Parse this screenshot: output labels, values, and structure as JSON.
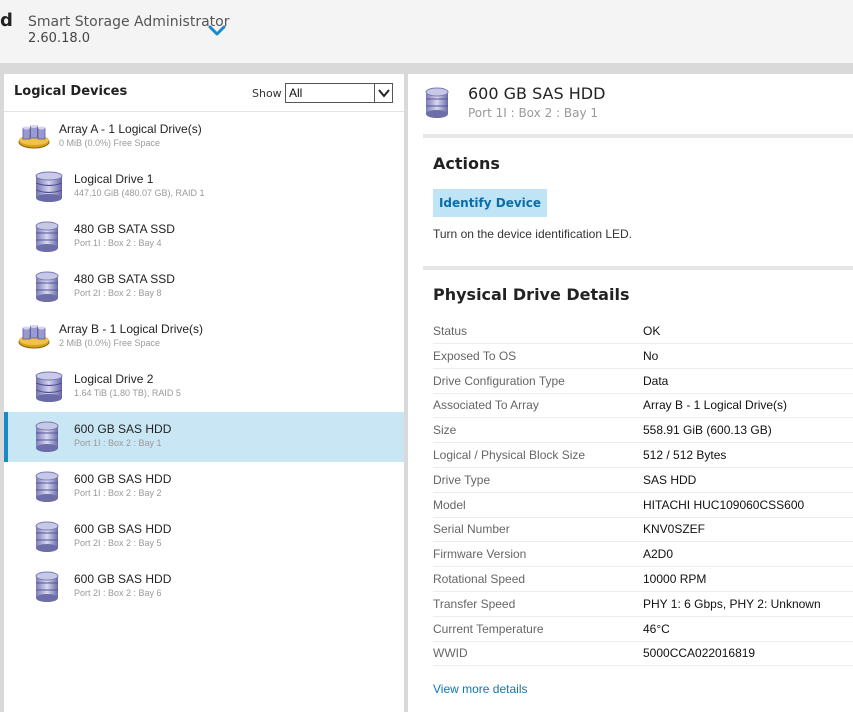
{
  "header": {
    "brand_letter": "d",
    "app_title": "Smart Storage Administrator",
    "app_version": "2.60.18.0"
  },
  "left": {
    "title": "Logical Devices",
    "show_label": "Show",
    "show_value": "All",
    "items": [
      {
        "name": "Array A - 1 Logical Drive(s)",
        "sub": "0 MiB (0.0%) Free Space",
        "kind": "array"
      },
      {
        "name": "Logical Drive 1",
        "sub": "447.10 GiB (480.07 GB), RAID 1",
        "kind": "logical"
      },
      {
        "name": "480 GB SATA SSD",
        "sub": "Port 1I : Box 2 : Bay 4",
        "kind": "physical"
      },
      {
        "name": "480 GB SATA SSD",
        "sub": "Port 2I : Box 2 : Bay 8",
        "kind": "physical"
      },
      {
        "name": "Array B - 1 Logical Drive(s)",
        "sub": "2 MiB (0.0%) Free Space",
        "kind": "array"
      },
      {
        "name": "Logical Drive 2",
        "sub": "1.64 TiB (1.80 TB), RAID 5",
        "kind": "logical"
      },
      {
        "name": "600 GB SAS HDD",
        "sub": "Port 1I : Box 2 : Bay 1",
        "kind": "physical",
        "selected": true
      },
      {
        "name": "600 GB SAS HDD",
        "sub": "Port 1I : Box 2 : Bay 2",
        "kind": "physical"
      },
      {
        "name": "600 GB SAS HDD",
        "sub": "Port 2I : Box 2 : Bay 5",
        "kind": "physical"
      },
      {
        "name": "600 GB SAS HDD",
        "sub": "Port 2I : Box 2 : Bay 6",
        "kind": "physical"
      }
    ]
  },
  "right": {
    "title": "600 GB SAS HDD",
    "subtitle": "Port 1I : Box 2 : Bay 1",
    "actions_title": "Actions",
    "identify_label": "Identify Device",
    "identify_desc": "Turn on the device identification LED.",
    "details_title": "Physical Drive Details",
    "details": [
      {
        "label": "Status",
        "value": "OK"
      },
      {
        "label": "Exposed To OS",
        "value": "No"
      },
      {
        "label": "Drive Configuration Type",
        "value": "Data"
      },
      {
        "label": "Associated To Array",
        "value": "Array B - 1 Logical Drive(s)"
      },
      {
        "label": "Size",
        "value": "558.91 GiB (600.13 GB)"
      },
      {
        "label": "Logical / Physical Block Size",
        "value": "512 / 512 Bytes"
      },
      {
        "label": "Drive Type",
        "value": "SAS HDD"
      },
      {
        "label": "Model",
        "value": "HITACHI HUC109060CSS600"
      },
      {
        "label": "Serial Number",
        "value": "KNV0SZEF"
      },
      {
        "label": "Firmware Version",
        "value": "A2D0"
      },
      {
        "label": "Rotational Speed",
        "value": "10000 RPM"
      },
      {
        "label": "Transfer Speed",
        "value": "PHY 1: 6 Gbps, PHY 2: Unknown"
      },
      {
        "label": "Current Temperature",
        "value": "46°C"
      },
      {
        "label": "WWID",
        "value": "5000CCA022016819"
      }
    ],
    "more_link": "View more details"
  },
  "colors": {
    "accent": "#1a89c8",
    "selected_bg": "#c9e6f5",
    "button_bg": "#bfe4f5",
    "link": "#0b78b5"
  }
}
